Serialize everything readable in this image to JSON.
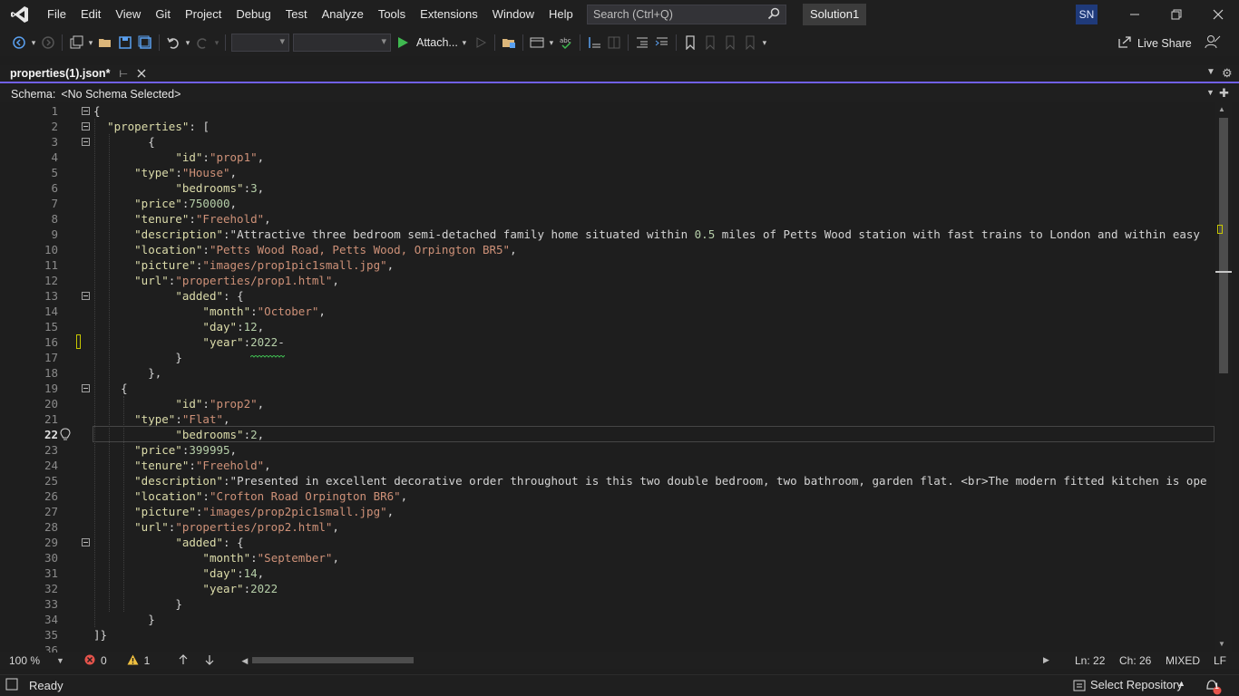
{
  "menu": {
    "items": [
      "File",
      "Edit",
      "View",
      "Git",
      "Project",
      "Debug",
      "Test",
      "Analyze",
      "Tools",
      "Extensions",
      "Window",
      "Help"
    ],
    "search_placeholder": "Search (Ctrl+Q)",
    "solution_name": "Solution1",
    "user_initials": "SN"
  },
  "toolbar": {
    "attach_label": "Attach...",
    "live_share_label": "Live Share"
  },
  "tab": {
    "title": "properties(1).json*"
  },
  "schema": {
    "label": "Schema:",
    "value": "<No Schema Selected>"
  },
  "editor": {
    "current_line": 22,
    "lines": [
      "{",
      "  \"properties\": [",
      "        {",
      "            \"id\":\"prop1\",",
      "      \"type\":\"House\",",
      "            \"bedrooms\":3,",
      "      \"price\":750000,",
      "      \"tenure\":\"Freehold\",",
      "      \"description\":\"Attractive three bedroom semi-detached family home situated within 0.5 miles of Petts Wood station with fast trains to London and within easy",
      "      \"location\":\"Petts Wood Road, Petts Wood, Orpington BR5\",",
      "      \"picture\":\"images/prop1pic1small.jpg\",",
      "      \"url\":\"properties/prop1.html\",",
      "            \"added\": {",
      "                \"month\":\"October\",",
      "                \"day\":12,",
      "                \"year\":2022-",
      "            }",
      "        },",
      "    {",
      "            \"id\":\"prop2\",",
      "      \"type\":\"Flat\",",
      "            \"bedrooms\":2,",
      "      \"price\":399995,",
      "      \"tenure\":\"Freehold\",",
      "      \"description\":\"Presented in excellent decorative order throughout is this two double bedroom, two bathroom, garden flat. <br>The modern fitted kitchen is ope",
      "      \"location\":\"Crofton Road Orpington BR6\",",
      "      \"picture\":\"images/prop2pic1small.jpg\",",
      "      \"url\":\"properties/prop2.html\",",
      "            \"added\": {",
      "                \"month\":\"September\",",
      "                \"day\":14,",
      "                \"year\":2022",
      "            }",
      "        }",
      "]}",
      ""
    ]
  },
  "editor_status": {
    "zoom": "100 %",
    "errors": "0",
    "warnings": "1",
    "line": "Ln: 22",
    "column": "Ch: 26",
    "line_endings_mode": "MIXED",
    "eol": "LF"
  },
  "statusbar": {
    "ready": "Ready",
    "select_repository": "Select Repository",
    "notifications": "1"
  },
  "colors": {
    "accent": "#7160e8",
    "string": "#ce9178",
    "number": "#b5cea8",
    "key": "#dcdcaa"
  }
}
